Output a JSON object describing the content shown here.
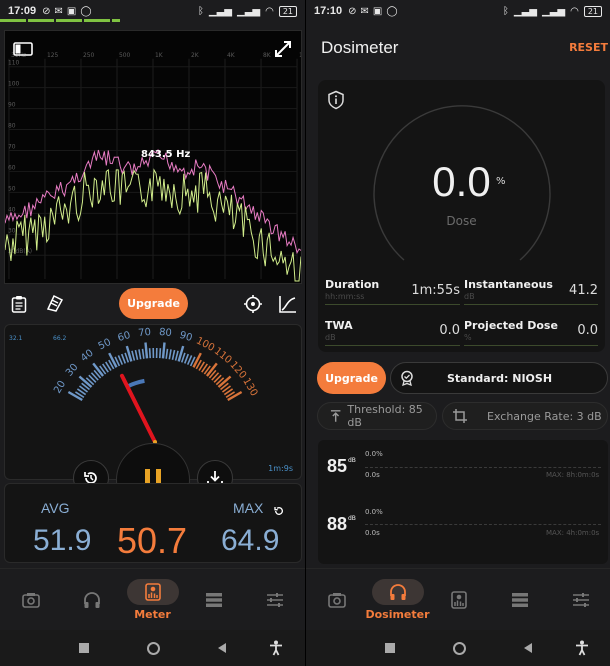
{
  "left": {
    "status": {
      "time": "17:09",
      "battery": "21"
    },
    "spectrum": {
      "freq_labels": [
        "31Hz",
        "125",
        "250",
        "500",
        "1K",
        "2K",
        "4K",
        "8K",
        "16K"
      ],
      "db_labels": [
        "110",
        "100",
        "90",
        "80",
        "70",
        "60",
        "50",
        "40",
        "30",
        "20dB(A)"
      ],
      "peak_label": "843.5 Hz"
    },
    "toolbar": {
      "upgrade_label": "Upgrade"
    },
    "meter": {
      "scale": [
        "20",
        "30",
        "40",
        "50",
        "60",
        "70",
        "80",
        "90",
        "100",
        "110",
        "120",
        "130"
      ],
      "top_left": "32.1",
      "top_mid": "66.2",
      "elapsed": "1m:9s",
      "needle_value": 50.7
    },
    "stats": {
      "avg_label": "AVG",
      "avg_value": "51.9",
      "current_value": "50.7",
      "max_label": "MAX",
      "max_value": "64.9"
    },
    "nav": {
      "active_label": "Meter"
    }
  },
  "right": {
    "status": {
      "time": "17:10",
      "battery": "21"
    },
    "title": "Dosimeter",
    "reset_label": "RESET",
    "dose": {
      "value": "0.0",
      "unit": "%",
      "label": "Dose"
    },
    "metrics": {
      "duration": {
        "title": "Duration",
        "sub": "hh:mm:ss",
        "value": "1m:55s"
      },
      "instantaneous": {
        "title": "Instantaneous",
        "sub": "dB",
        "value": "41.2"
      },
      "twa": {
        "title": "TWA",
        "sub": "dB",
        "value": "0.0"
      },
      "projected": {
        "title": "Projected Dose",
        "sub": "%",
        "value": "0.0"
      }
    },
    "upgrade_label": "Upgrade",
    "standard_label": "Standard: NIOSH",
    "threshold_label": "Threshold: 85 dB",
    "exchange_label": "Exchange Rate: 3 dB",
    "history": [
      {
        "level": "85",
        "unit": "dB",
        "pct": "0.0%",
        "time": "0.0s",
        "max": "MAX: 8h:0m:0s"
      },
      {
        "level": "88",
        "unit": "dB",
        "pct": "0.0%",
        "time": "0.0s",
        "max": "MAX: 4h:0m:0s"
      }
    ],
    "nav": {
      "active_label": "Dosimeter"
    }
  },
  "colors": {
    "accent": "#f47c3c",
    "meter_blue": "#8aaed4",
    "needle": "#e0141e",
    "pause": "#e8a325"
  },
  "icons": [
    "battery-icon",
    "bluetooth-icon",
    "wifi-icon",
    "signal-icon",
    "alarm-off-icon",
    "gmail-icon",
    "camera-icon",
    "headphones-icon",
    "meter-icon",
    "list-icon",
    "sliders-icon",
    "info-icon",
    "badge-icon",
    "clipboard-icon",
    "bookmark-icon",
    "target-icon",
    "chart-icon",
    "expand-icon",
    "sidebar-icon",
    "reset-history-icon",
    "download-icon",
    "pause-icon"
  ]
}
